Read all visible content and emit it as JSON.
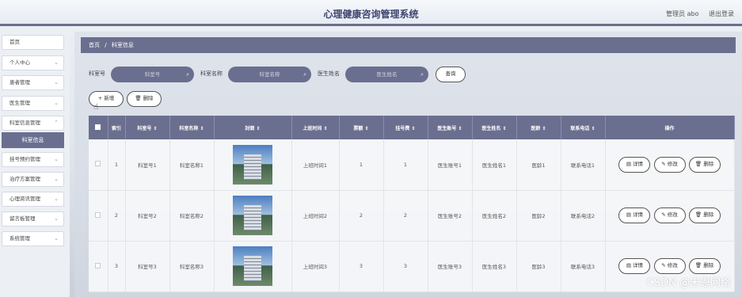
{
  "header": {
    "title": "心理健康咨询管理系统",
    "user": "管理员 abo",
    "logout": "退出登录"
  },
  "sidebar": {
    "items": [
      {
        "label": "首页",
        "chevron": false
      },
      {
        "label": "个人中心",
        "chevron": true
      },
      {
        "label": "患者管理",
        "chevron": true
      },
      {
        "label": "医生管理",
        "chevron": true
      },
      {
        "label": "科室信息管理",
        "chevron": true
      },
      {
        "label": "挂号预约管理",
        "chevron": true
      },
      {
        "label": "治疗方案管理",
        "chevron": true
      },
      {
        "label": "心理资讯管理",
        "chevron": true
      },
      {
        "label": "留言板管理",
        "chevron": true
      },
      {
        "label": "系统管理",
        "chevron": true
      }
    ],
    "active_sub": "科室信息"
  },
  "breadcrumb": {
    "home": "首页",
    "sep": "/",
    "current": "科室信息"
  },
  "search": {
    "dept_no_label": "科室号",
    "dept_no_placeholder": "科室号",
    "dept_name_label": "科室名称",
    "dept_name_placeholder": "科室名称",
    "doctor_label": "医生姓名",
    "doctor_placeholder": "医生姓名",
    "query_button": "查询"
  },
  "actions": {
    "add": "新增",
    "delete": "删除"
  },
  "table": {
    "headers": [
      "索引",
      "科室号",
      "科室名称",
      "封面",
      "上班时间",
      "票额",
      "挂号费",
      "医生账号",
      "医生姓名",
      "医龄",
      "联系电话",
      "操作"
    ],
    "sort_mark": "⇕",
    "rows": [
      {
        "index": "1",
        "dept_no": "科室号1",
        "dept_name": "科室名称1",
        "work_time": "上班时间1",
        "quota": "1",
        "fee": "1",
        "doc_account": "医生账号1",
        "doc_name": "医生姓名1",
        "age": "医龄1",
        "phone": "联系电话1"
      },
      {
        "index": "2",
        "dept_no": "科室号2",
        "dept_name": "科室名称2",
        "work_time": "上班时间2",
        "quota": "2",
        "fee": "2",
        "doc_account": "医生账号2",
        "doc_name": "医生姓名2",
        "age": "医龄2",
        "phone": "联系电话2"
      },
      {
        "index": "3",
        "dept_no": "科室号3",
        "dept_name": "科室名称3",
        "work_time": "上班时间3",
        "quota": "3",
        "fee": "3",
        "doc_account": "医生账号3",
        "doc_name": "医生姓名3",
        "age": "医龄3",
        "phone": "联系电话3"
      }
    ],
    "row_buttons": {
      "detail": "详情",
      "edit": "修改",
      "delete": "删除"
    }
  },
  "watermark": "CSDN @米恩网络",
  "icons": {
    "search": "search-icon",
    "add": "plus-icon",
    "delete": "trash-icon",
    "edit": "edit-icon",
    "detail": "doc-icon"
  }
}
